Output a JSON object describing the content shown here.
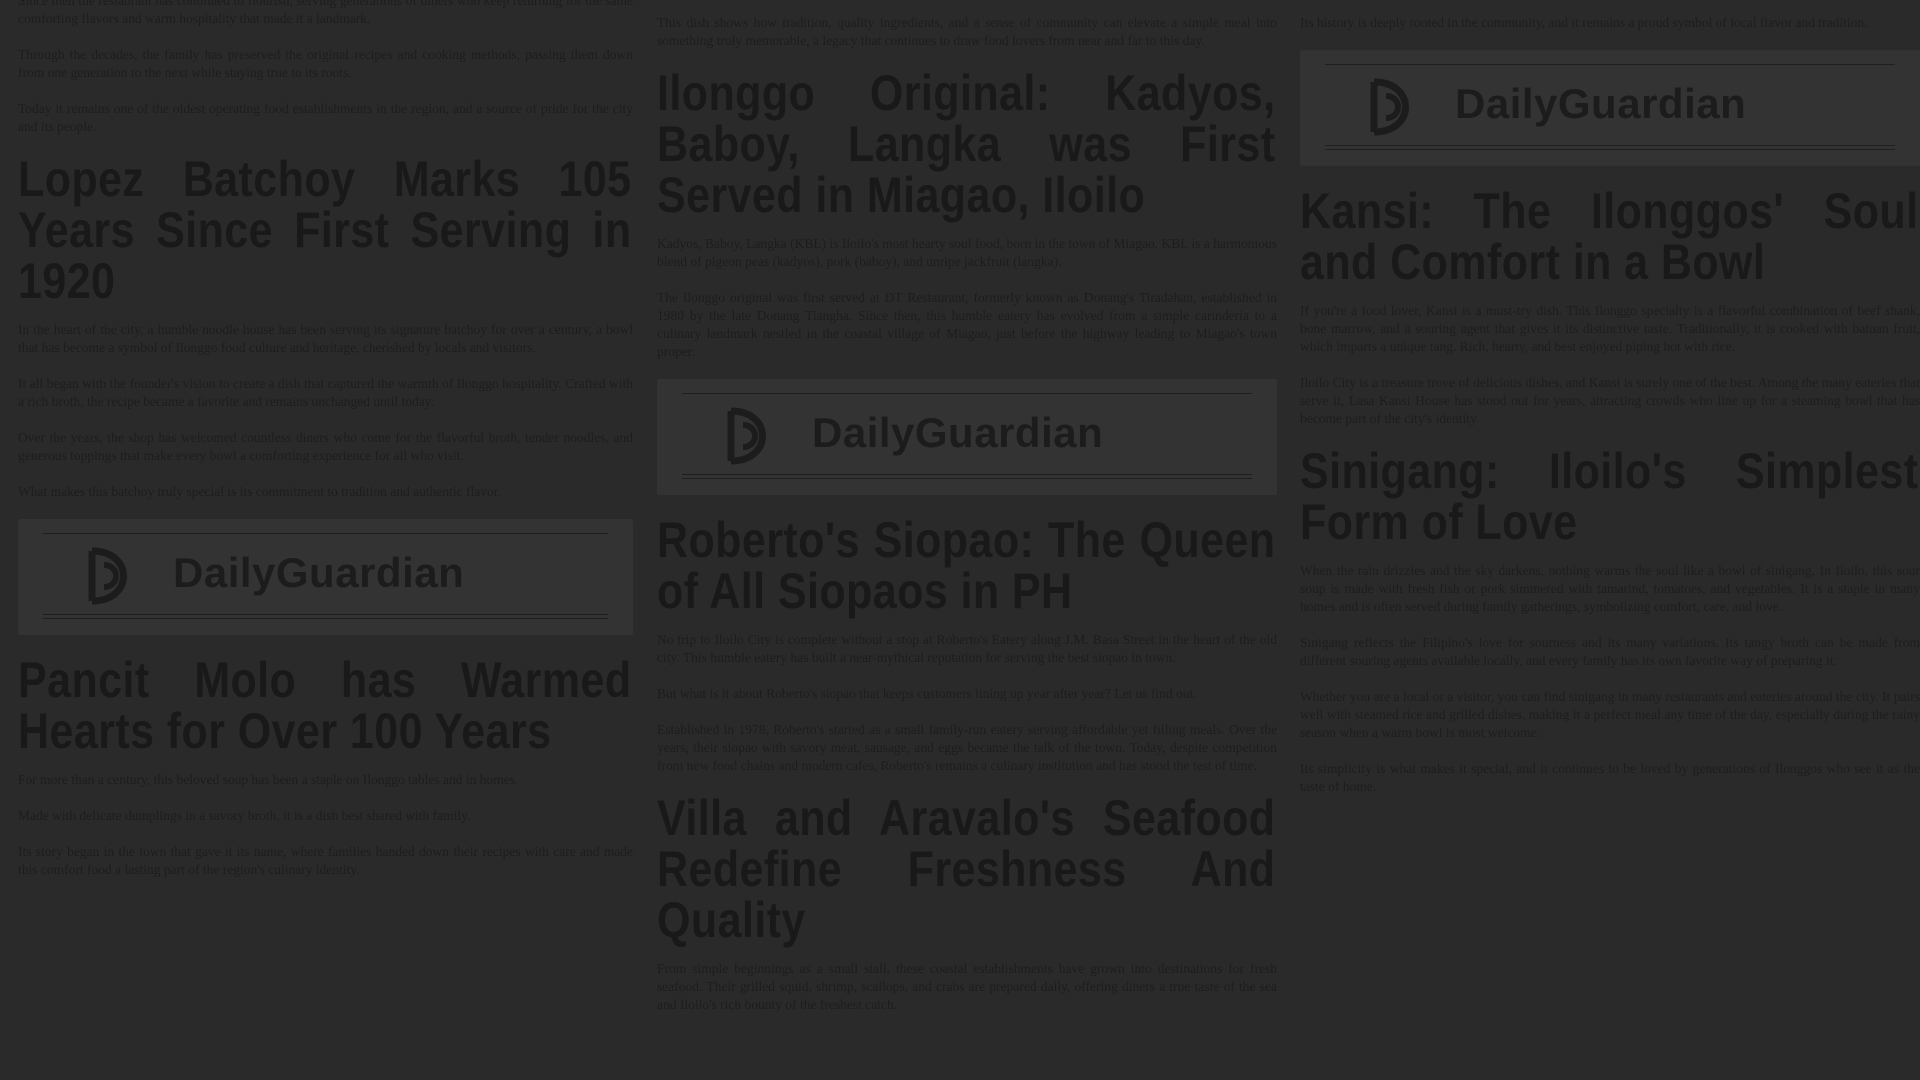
{
  "brand": {
    "name": "DailyGuardian"
  },
  "colors": {
    "background": "#2a2a2a",
    "banner": "#333333",
    "text": "#1d1d1d"
  },
  "left_column": {
    "top_paragraphs": [
      "Since then the restaurant has continued to flourish, serving generations of diners who keep returning for the same comforting flavors and warm hospitality that made it a landmark.",
      "Through the decades, the family has preserved the original recipes and cooking methods, passing them down from one generation to the next while staying true to its roots.",
      "Today it remains one of the oldest operating food establishments in the region, and a source of pride for the city and its people."
    ],
    "headline_1": "Lopez Batchoy Marks 105 Years Since First Serving in 1920",
    "body_1": [
      "In the heart of the city, a humble noodle house has been serving its signature batchoy for over a century, a bowl that has become a symbol of Ilonggo food culture and heritage, cherished by locals and visitors.",
      "It all began with the founder's vision to create a dish that captured the warmth of Ilonggo hospitality. Crafted with a rich broth, the recipe became a favorite and remains unchanged until today.",
      "Over the years, the shop has welcomed countless diners who come for the flavorful broth, tender noodles, and generous toppings that make every bowl a comforting experience for all who visit.",
      "What makes this batchoy truly special is its commitment to tradition and authentic flavor."
    ],
    "headline_2": "Pancit Molo has Warmed Hearts for Over 100 Years",
    "body_2": [
      "For more than a century, this beloved soup has been a staple on Ilonggo tables and in homes.",
      "Made with delicate dumplings in a savory broth, it is a dish best shared with family.",
      "Its story began in the town that gave it its name, where families handed down their recipes with care and made this comfort food a lasting part of the region's culinary identity."
    ]
  },
  "middle_column": {
    "top_paragraph": "This dish shows how tradition, quality ingredients, and a sense of community can elevate a simple meal into something truly memorable, a legacy that continues to draw food lovers from near and far to this day.",
    "headline_1": "Ilonggo Original: Kadyos, Baboy, Langka was First Served in Miagao, Iloilo",
    "body_1": [
      "Kadyos, Baboy, Langka (KBL) is Iloilo's most hearty soul food, born in the town of Miagao. KBL is a harmonious blend of pigeon peas (kadyos), pork (baboy), and unripe jackfruit (langka).",
      "The Ilonggo original was first served at DT Restaurant, formerly known as Donang's Tiradahan, established in 1980 by the late Donang Tiangha. Since then, this humble eatery has evolved from a simple carinderia to a culinary landmark nestled in the coastal village of Miagao, just before the highway leading to Miagao's town proper."
    ],
    "headline_2": "Roberto's Siopao: The Queen of All Siopaos in PH",
    "body_2": [
      "No trip to Iloilo City is complete without a stop at Roberto's Eatery along J.M. Basa Street in the heart of the old city. This humble eatery has built a near-mythical reputation for serving the best siopao in town.",
      "But what is it about Roberto's siopao that keeps customers lining up year after year? Let us find out.",
      "Established in 1978, Roberto's started as a small family-run eatery serving affordable yet filling meals. Over the years, their siopao with savory meat, sausage, and eggs became the talk of the town. Today, despite competition from new food chains and modern cafes, Roberto's remains a culinary institution and has stood the test of time."
    ],
    "headline_3": "Villa and Aravalo's Seafood Redefine Freshness And Quality",
    "body_3": [
      "From simple beginnings as a small stall, these coastal establishments have grown into destinations for fresh seafood. Their grilled squid, shrimp, scallops, and crabs are prepared daily, offering diners a true taste of the sea and Iloilo's rich bounty of the freshest catch."
    ]
  },
  "right_column": {
    "top_paragraph": "Its history is deeply rooted in the community, and it remains a proud symbol of local flavor and tradition.",
    "headline_1": "Kansi: The Ilonggos' Soul and Comfort in a Bowl",
    "body_1": [
      "If you're a food lover, Kansi is a must-try dish. This Ilonggo specialty is a flavorful combination of beef shank, bone marrow, and a souring agent that gives it its distinctive taste. Traditionally, it is cooked with batuan fruit, which imparts a unique tang. Rich, hearty, and best enjoyed piping hot with rice.",
      "Iloilo City is a treasure trove of delicious dishes, and Kansi is surely one of the best. Among the many eateries that serve it, Lasa Kansi House has stood out for years, attracting crowds who line up for a steaming bowl that has become part of the city's identity."
    ],
    "headline_2": "Sinigang: Iloilo's Simplest Form of Love",
    "body_2": [
      "When the rain drizzles and the sky darkens, nothing warms the soul like a bowl of sinigang. In Iloilo, this sour soup is made with fresh fish or pork simmered with tamarind, tomatoes, and vegetables. It is a staple in many homes and is often served during family gatherings, symbolizing comfort, care, and love.",
      "Sinigang reflects the Filipino's love for sourness and its many variations. Its tangy broth can be made from different souring agents available locally, and every family has its own favorite way of preparing it.",
      "Whether you are a local or a visitor, you can find sinigang in many restaurants and eateries around the city. It pairs well with steamed rice and grilled dishes, making it a perfect meal any time of the day, especially during the rainy season when a warm bowl is most welcome.",
      "Its simplicity is what makes it special, and it continues to be loved by generations of Ilonggos who see it as the taste of home."
    ]
  }
}
